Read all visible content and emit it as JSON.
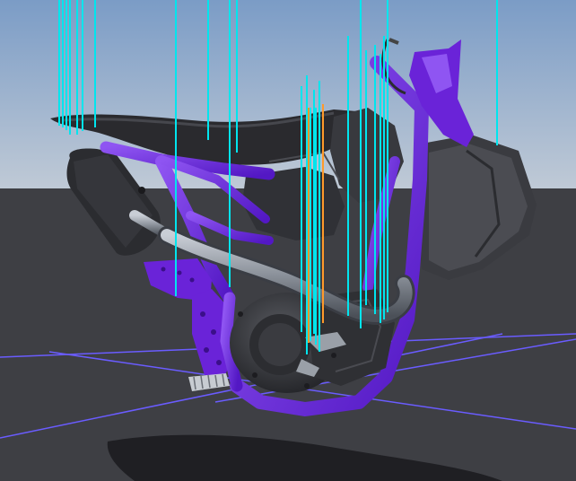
{
  "viewport": {
    "sky_top_color": "#7b9cc6",
    "sky_horizon_color": "#c0cad6",
    "ground_color": "#3e3f44",
    "grid_color": "#6a5cff",
    "frame_color": "#6a23d8",
    "frame_highlight_color": "#8f55f2",
    "plastic_color": "#2f2f33",
    "ray_color": "#00e5ee",
    "ray_alt_color": "#ff9a2a"
  },
  "model": {
    "name_icon": "motorcycle-3d-model",
    "parts": [
      "seat",
      "fuel-tank",
      "radiator-shroud",
      "exhaust-muffler",
      "engine",
      "rear-subframe",
      "main-frame",
      "footpeg",
      "headpipe",
      "shadow"
    ]
  }
}
